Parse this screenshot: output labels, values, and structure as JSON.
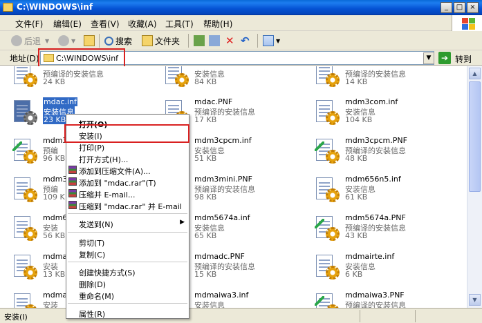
{
  "window": {
    "title": "C:\\WINDOWS\\inf",
    "buttons": {
      "minimize": "_",
      "maximize": "□",
      "close": "×"
    }
  },
  "menubar": [
    "文件(F)",
    "编辑(E)",
    "查看(V)",
    "收藏(A)",
    "工具(T)",
    "帮助(H)"
  ],
  "toolbar": {
    "back": "后退",
    "search": "搜索",
    "folders": "文件夹"
  },
  "addressbar": {
    "label": "地址(D)",
    "value": "C:\\WINDOWS\\inf",
    "go_label": "转到"
  },
  "files": [
    {
      "name": "",
      "type": "预编译的安装信息",
      "size": "24 KB"
    },
    {
      "name": "",
      "type": "安装信息",
      "size": "84 KB"
    },
    {
      "name": "",
      "type": "预编译的安装信息",
      "size": "14 KB"
    },
    {
      "name": "mdac.inf",
      "type": "安装信息",
      "size": "23 KB"
    },
    {
      "name": "mdac.PNF",
      "type": "预编译的安装信息",
      "size": "17 KB"
    },
    {
      "name": "mdm3com.inf",
      "type": "安装信息",
      "size": "104 KB"
    },
    {
      "name": "mdm3c",
      "type": "预编",
      "size": "96 KB"
    },
    {
      "name": "mdm3cpcm.inf",
      "type": "安装信息",
      "size": "51 KB"
    },
    {
      "name": "mdm3cpcm.PNF",
      "type": "预编译的安装信息",
      "size": "48 KB"
    },
    {
      "name": "mdm3n",
      "type": "预编",
      "size": "109 K"
    },
    {
      "name": "mdm3mini.PNF",
      "type": "预编译的安装信息",
      "size": "98 KB"
    },
    {
      "name": "mdm656n5.inf",
      "type": "安装信息",
      "size": "61 KB"
    },
    {
      "name": "mdm65",
      "type": "安装",
      "size": "56 KB"
    },
    {
      "name": "mdm5674a.inf",
      "type": "安装信息",
      "size": "65 KB"
    },
    {
      "name": "mdm5674a.PNF",
      "type": "预编译的安装信息",
      "size": "43 KB"
    },
    {
      "name": "mdmac",
      "type": "安装",
      "size": "13 KB"
    },
    {
      "name": "mdmadc.PNF",
      "type": "预编译的安装信息",
      "size": "15 KB"
    },
    {
      "name": "mdmairte.inf",
      "type": "安装信息",
      "size": "6 KB"
    },
    {
      "name": "mdmai",
      "type": "安装",
      "size": ""
    },
    {
      "name": "mdmaiwa3.inf",
      "type": "安装信息",
      "size": ""
    },
    {
      "name": "mdmaiwa3.PNF",
      "type": "预编译的安装信息",
      "size": ""
    }
  ],
  "context_menu": {
    "open": "打开(O)",
    "install": "安装(I)",
    "print": "打印(P)",
    "open_with": "打开方式(H)...",
    "add_archive": "添加到压缩文件(A)...",
    "add_rar": "添加到 \"mdac.rar\"(T)",
    "compress_email": "压缩并 E-mail...",
    "compress_rar_email": "压缩到 \"mdac.rar\" 并 E-mail",
    "send_to": "发送到(N)",
    "cut": "剪切(T)",
    "copy": "复制(C)",
    "create_shortcut": "创建快捷方式(S)",
    "delete": "删除(D)",
    "rename": "重命名(M)",
    "properties": "属性(R)"
  },
  "statusbar": {
    "text": "安装(I)"
  },
  "colors": {
    "title_blue": "#0552d4",
    "selection": "#316ac5",
    "highlight_red": "#d92020"
  }
}
